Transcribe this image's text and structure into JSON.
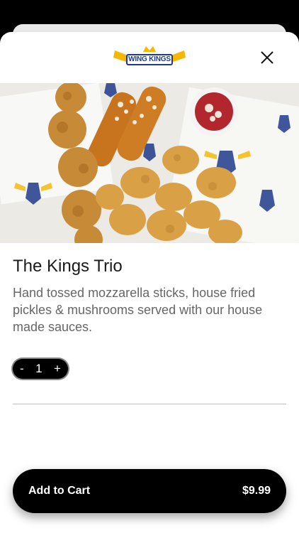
{
  "brand": {
    "logo_text": "WING KINGS",
    "accent": "#f5b700",
    "navy": "#1e3a8a"
  },
  "header": {
    "close_icon": "close-icon"
  },
  "item": {
    "title": "The Kings Trio",
    "description": "Hand tossed mozzarella sticks, house fried pickles & mushrooms served with our house made sauces."
  },
  "quantity": {
    "minus": "-",
    "value": "1",
    "plus": "+"
  },
  "cart": {
    "label": "Add to Cart",
    "price": "$9.99"
  }
}
